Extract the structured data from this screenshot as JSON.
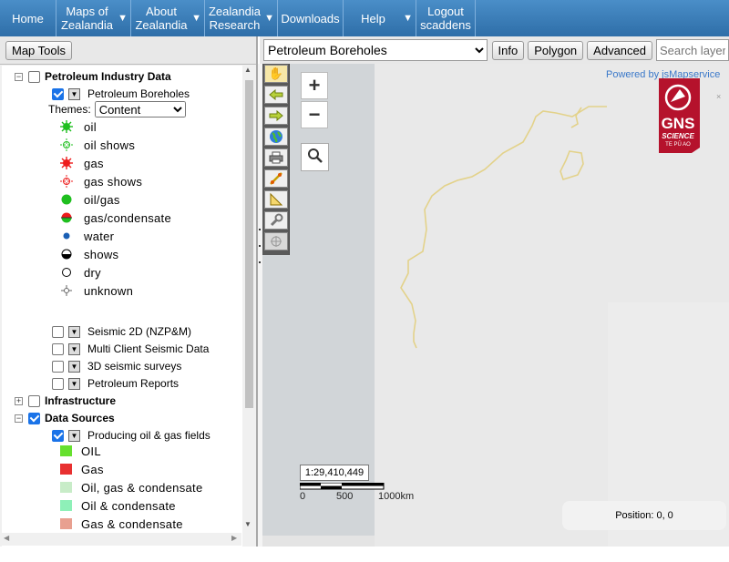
{
  "nav": {
    "home": "Home",
    "maps_line1": "Maps of",
    "maps_line2": "Zealandia",
    "about_line1": "About",
    "about_line2": "Zealandia",
    "research_line1": "Zealandia",
    "research_line2": "Research",
    "downloads": "Downloads",
    "help": "Help",
    "logout_line1": "Logout",
    "logout_line2": "scaddens",
    "dropdown_glyph": "▼"
  },
  "left": {
    "map_tools_label": "Map Tools",
    "groups": {
      "petroleum": {
        "label": "Petroleum Industry Data",
        "expander": "−",
        "checked": false
      },
      "infrastructure": {
        "label": "Infrastructure",
        "expander": "+",
        "checked": false
      },
      "data_sources": {
        "label": "Data Sources",
        "expander": "−",
        "checked": true
      }
    },
    "layers": {
      "boreholes": "Petroleum Boreholes",
      "seismic2d": "Seismic 2D (NZP&M)",
      "multiclient": "Multi Client Seismic Data",
      "seismic3d": "3D seismic surveys",
      "reports": "Petroleum Reports",
      "producing": "Producing oil & gas fields"
    },
    "themes_label": "Themes:",
    "themes_value": "Content",
    "borehole_legend": [
      "oil",
      "oil shows",
      "gas",
      "gas shows",
      "oil/gas",
      "gas/condensate",
      "water",
      "shows",
      "dry",
      "unknown"
    ],
    "field_legend": [
      {
        "label": "OIL",
        "color": "#66e02e"
      },
      {
        "label": "Gas",
        "color": "#e83030"
      },
      {
        "label": "Oil, gas & condensate",
        "color": "#c8ecc8"
      },
      {
        "label": "Oil & condensate",
        "color": "#8ef0b8"
      },
      {
        "label": "Gas & condensate",
        "color": "#e8a090"
      }
    ]
  },
  "toolbar": {
    "selected_layer": "Petroleum Boreholes",
    "info": "Info",
    "polygon": "Polygon",
    "advanced": "Advanced",
    "search_placeholder": "Search layers"
  },
  "map": {
    "powered_by": "Powered by jsMapservice",
    "zoom_in": "+",
    "zoom_out": "−",
    "scale": "1:29,410,449",
    "scale_ticks": [
      "0",
      "500",
      "1000km"
    ],
    "position": "Position: 0, 0",
    "logo_text": "GNS",
    "logo_sub": "SCIENCE",
    "logo_maori": "TE PŪ AO",
    "close": "×",
    "boundary_color": "#e3d28a"
  }
}
